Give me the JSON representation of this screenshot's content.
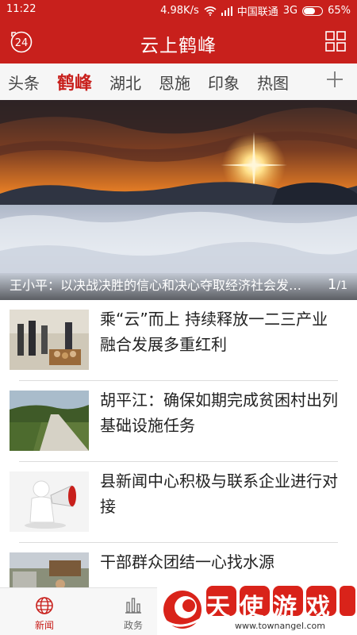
{
  "status_bar": {
    "time": "11:22",
    "speed": "4.98K/s",
    "carrier": "中国联通",
    "network": "3G",
    "battery": "65%",
    "battery_level": 0.65
  },
  "header": {
    "title": "云上鹤峰",
    "badge_text": "24",
    "menu_icon": "grid-icon"
  },
  "tabs": [
    {
      "label": "头条",
      "active": false
    },
    {
      "label": "鹤峰",
      "active": true
    },
    {
      "label": "湖北",
      "active": false
    },
    {
      "label": "恩施",
      "active": false
    },
    {
      "label": "印象",
      "active": false
    },
    {
      "label": "热图",
      "active": false
    }
  ],
  "hero": {
    "caption": "王小平：以决战决胜的信心和决心夺取经济社会发展新胜利",
    "pager_current": "1",
    "pager_total": "1"
  },
  "news": [
    {
      "title": "乘“云”而上 持续释放一二三产业融合发展多重红利"
    },
    {
      "title": "胡平江：确保如期完成贫困村出列基础设施任务"
    },
    {
      "title": "县新闻中心积极与联系企业进行对接"
    },
    {
      "title": "干部群众团结一心找水源"
    }
  ],
  "bottom_nav": [
    {
      "label": "新闻",
      "icon": "globe-icon",
      "active": true
    },
    {
      "label": "政务",
      "icon": "bar-chart-icon",
      "active": false
    }
  ],
  "watermark": {
    "text": "天使游戏网",
    "url": "www.townangel.com"
  },
  "colors": {
    "brand_red": "#c8201c",
    "tab_active": "#c8201c",
    "watermark_red": "#d9231a"
  }
}
